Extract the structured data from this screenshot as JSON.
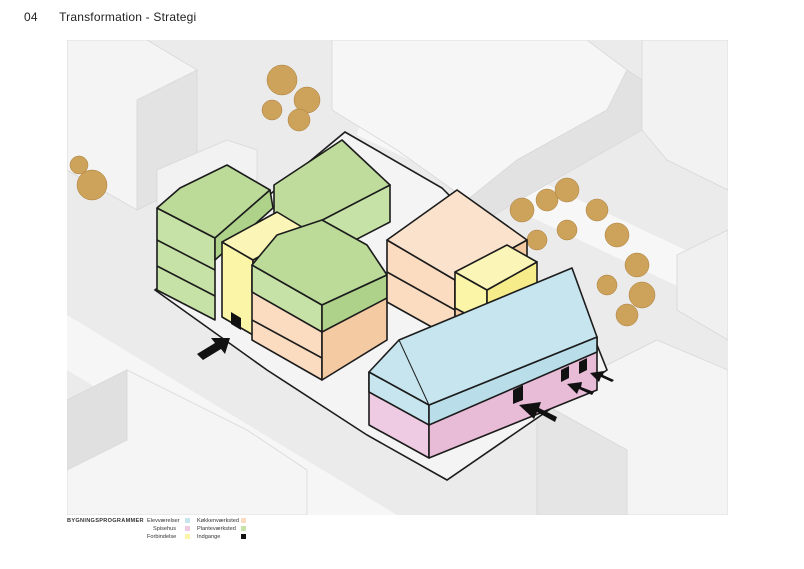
{
  "header": {
    "page_number": "04",
    "title": "Transformation - Strategi"
  },
  "legend": {
    "title": "BYGNINGSPROGRAMMER",
    "items": [
      {
        "label": "Elevværelser",
        "color": "#c6e5ee"
      },
      {
        "label": "Spisehus",
        "color": "#eecbe2"
      },
      {
        "label": "Forbindelse",
        "color": "#fbf5a8"
      },
      {
        "label": "Køkkenværksted",
        "color": "#fbdcc0"
      },
      {
        "label": "Planteværksted",
        "color": "#c7e2a7"
      },
      {
        "label": "Indgange",
        "color": "#111111"
      }
    ]
  }
}
